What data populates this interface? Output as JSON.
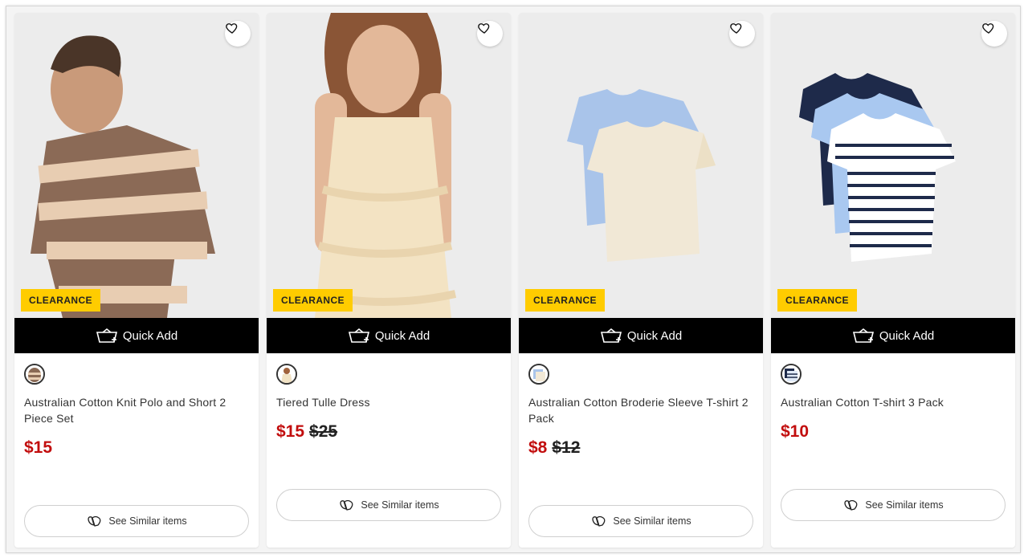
{
  "colors": {
    "badge": "#ffcc00",
    "sale_price": "#c20e0e",
    "quick_add_bg": "#000000"
  },
  "icons": {
    "wishlist": "heart-icon",
    "quick_add": "basket-icon",
    "similar": "hanger-hearts-icon"
  },
  "products": [
    {
      "name": "Australian Cotton Knit Polo and Short 2 Piece Set",
      "badge": "CLEARANCE",
      "quick_add": "Quick Add",
      "price": "$15",
      "was_price": "",
      "similar": "See Similar items",
      "swatch_color": "#8a6a55"
    },
    {
      "name": "Tiered Tulle Dress",
      "badge": "CLEARANCE",
      "quick_add": "Quick Add",
      "price": "$15",
      "was_price": "$25",
      "similar": "See Similar items",
      "swatch_color": "#f1e2c4"
    },
    {
      "name": "Australian Cotton Broderie Sleeve T-shirt 2 Pack",
      "badge": "CLEARANCE",
      "quick_add": "Quick Add",
      "price": "$8",
      "was_price": "$12",
      "similar": "See Similar items",
      "swatch_color": "#a9c4ea"
    },
    {
      "name": "Australian Cotton T-shirt 3 Pack",
      "badge": "CLEARANCE",
      "quick_add": "Quick Add",
      "price": "$10",
      "was_price": "",
      "similar": "See Similar items",
      "swatch_color": "#1e2a4a"
    }
  ]
}
